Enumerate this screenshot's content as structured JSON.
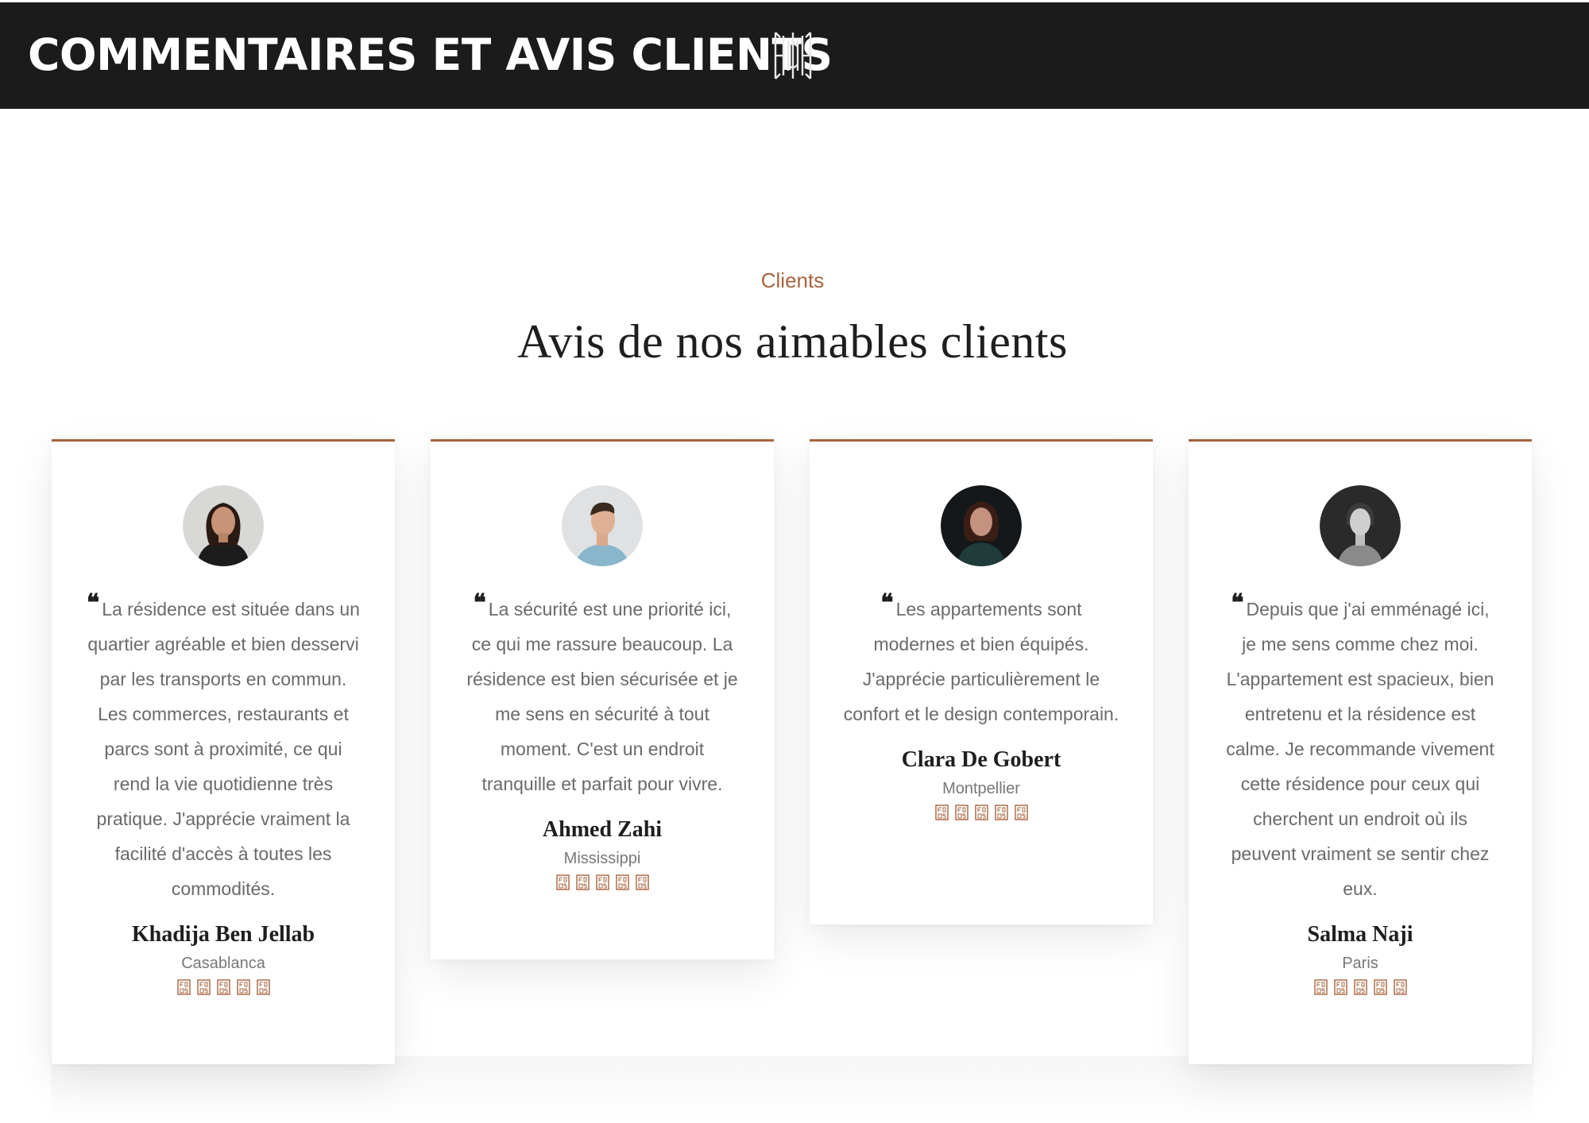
{
  "header": {
    "title": "COMMENTAIRES ET AVIS CLIENTS",
    "logo_icon": "hsh-monogram-logo"
  },
  "section": {
    "eyebrow": "Clients",
    "title": "Avis de nos aimables clients"
  },
  "colors": {
    "accent": "#a8643e",
    "header_bg": "#1b1b1b",
    "text_dark": "#1e1e1e",
    "text_muted": "#6a6a6a"
  },
  "testimonials": [
    {
      "quote": "La résidence est située dans un quartier agréable et bien desservi par les transports en commun. Les commerces, restaurants et parcs sont à proximité, ce qui rend la vie quotidienne très pratique. J'apprécie vraiment la facilité d'accès à toutes les commodités.",
      "name": "Khadija Ben Jellab",
      "city": "Casablanca",
      "rating": 5,
      "avatar_icon": "avatar-woman-long-hair"
    },
    {
      "quote": "La sécurité est une priorité ici, ce qui me rassure beaucoup. La résidence est bien sécurisée et je me sens en sécurité à tout moment. C'est un endroit tranquille et parfait pour vivre.",
      "name": "Ahmed Zahi",
      "city": "Mississippi",
      "rating": 5,
      "avatar_icon": "avatar-man-profile"
    },
    {
      "quote": "Les appartements sont modernes et bien équipés. J'apprécie particulièrement le confort et le design contemporain.",
      "name": "Clara De Gobert",
      "city": "Montpellier",
      "rating": 5,
      "avatar_icon": "avatar-woman-dark"
    },
    {
      "quote": "Depuis que j'ai emménagé ici, je me sens comme chez moi. L'appartement est spacieux, bien entretenu et la résidence est calme. Je recommande vivement cette résidence pour ceux qui cherchent un endroit où ils peuvent vraiment se sentir chez eux.",
      "name": "Salma Naji",
      "city": "Paris",
      "rating": 5,
      "avatar_icon": "avatar-woman-bw"
    }
  ]
}
